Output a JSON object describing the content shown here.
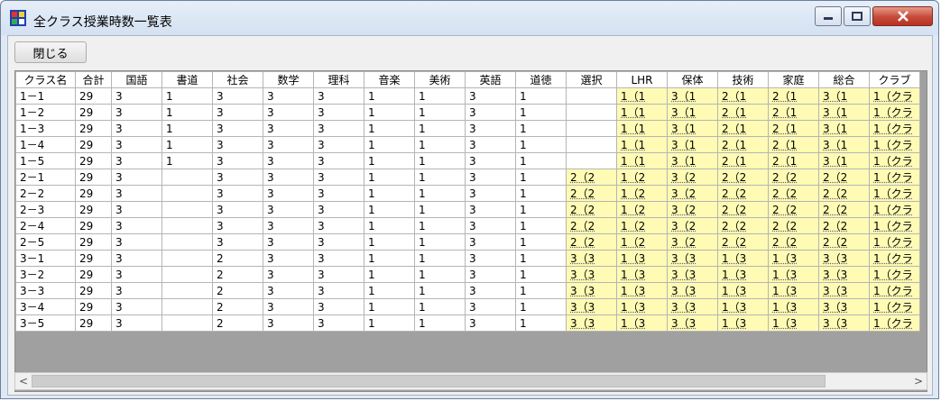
{
  "window": {
    "title": "全クラス授業時数一覧表",
    "close_label": "閉じる"
  },
  "table": {
    "columns": [
      "クラス名",
      "合計",
      "国語",
      "書道",
      "社会",
      "数学",
      "理科",
      "音楽",
      "美術",
      "英語",
      "道徳",
      "選択",
      "LHR",
      "保体",
      "技術",
      "家庭",
      "総合",
      "クラブ"
    ],
    "rows": [
      [
        "1－1",
        "29",
        "3",
        "1",
        "3",
        "3",
        "3",
        "1",
        "1",
        "3",
        "1",
        "",
        "1（1",
        "3（1",
        "2（1",
        "2（1",
        "3（1",
        "1（クラ"
      ],
      [
        "1－2",
        "29",
        "3",
        "1",
        "3",
        "3",
        "3",
        "1",
        "1",
        "3",
        "1",
        "",
        "1（1",
        "3（1",
        "2（1",
        "2（1",
        "3（1",
        "1（クラ"
      ],
      [
        "1－3",
        "29",
        "3",
        "1",
        "3",
        "3",
        "3",
        "1",
        "1",
        "3",
        "1",
        "",
        "1（1",
        "3（1",
        "2（1",
        "2（1",
        "3（1",
        "1（クラ"
      ],
      [
        "1－4",
        "29",
        "3",
        "1",
        "3",
        "3",
        "3",
        "1",
        "1",
        "3",
        "1",
        "",
        "1（1",
        "3（1",
        "2（1",
        "2（1",
        "3（1",
        "1（クラ"
      ],
      [
        "1－5",
        "29",
        "3",
        "1",
        "3",
        "3",
        "3",
        "1",
        "1",
        "3",
        "1",
        "",
        "1（1",
        "3（1",
        "2（1",
        "2（1",
        "3（1",
        "1（クラ"
      ],
      [
        "2－1",
        "29",
        "3",
        "",
        "3",
        "3",
        "3",
        "1",
        "1",
        "3",
        "1",
        "2（2",
        "1（2",
        "3（2",
        "2（2",
        "2（2",
        "2（2",
        "1（クラ"
      ],
      [
        "2－2",
        "29",
        "3",
        "",
        "3",
        "3",
        "3",
        "1",
        "1",
        "3",
        "1",
        "2（2",
        "1（2",
        "3（2",
        "2（2",
        "2（2",
        "2（2",
        "1（クラ"
      ],
      [
        "2－3",
        "29",
        "3",
        "",
        "3",
        "3",
        "3",
        "1",
        "1",
        "3",
        "1",
        "2（2",
        "1（2",
        "3（2",
        "2（2",
        "2（2",
        "2（2",
        "1（クラ"
      ],
      [
        "2－4",
        "29",
        "3",
        "",
        "3",
        "3",
        "3",
        "1",
        "1",
        "3",
        "1",
        "2（2",
        "1（2",
        "3（2",
        "2（2",
        "2（2",
        "2（2",
        "1（クラ"
      ],
      [
        "2－5",
        "29",
        "3",
        "",
        "3",
        "3",
        "3",
        "1",
        "1",
        "3",
        "1",
        "2（2",
        "1（2",
        "3（2",
        "2（2",
        "2（2",
        "2（2",
        "1（クラ"
      ],
      [
        "3－1",
        "29",
        "3",
        "",
        "2",
        "3",
        "3",
        "1",
        "1",
        "3",
        "1",
        "3（3",
        "1（3",
        "3（3",
        "1（3",
        "1（3",
        "3（3",
        "1（クラ"
      ],
      [
        "3－2",
        "29",
        "3",
        "",
        "2",
        "3",
        "3",
        "1",
        "1",
        "3",
        "1",
        "3（3",
        "1（3",
        "3（3",
        "1（3",
        "1（3",
        "3（3",
        "1（クラ"
      ],
      [
        "3－3",
        "29",
        "3",
        "",
        "2",
        "3",
        "3",
        "1",
        "1",
        "3",
        "1",
        "3（3",
        "1（3",
        "3（3",
        "1（3",
        "1（3",
        "3（3",
        "1（クラ"
      ],
      [
        "3－4",
        "29",
        "3",
        "",
        "2",
        "3",
        "3",
        "1",
        "1",
        "3",
        "1",
        "3（3",
        "1（3",
        "3（3",
        "1（3",
        "1（3",
        "3（3",
        "1（クラ"
      ],
      [
        "3－5",
        "29",
        "3",
        "",
        "2",
        "3",
        "3",
        "1",
        "1",
        "3",
        "1",
        "3（3",
        "1（3",
        "3（3",
        "1（3",
        "1（3",
        "3（3",
        "1（クラ"
      ]
    ]
  },
  "scrollbar": {
    "left_arrow": "<",
    "right_arrow": ">"
  },
  "colors": {
    "highlight": "#fffbb4",
    "close_button": "#c54a3a"
  }
}
